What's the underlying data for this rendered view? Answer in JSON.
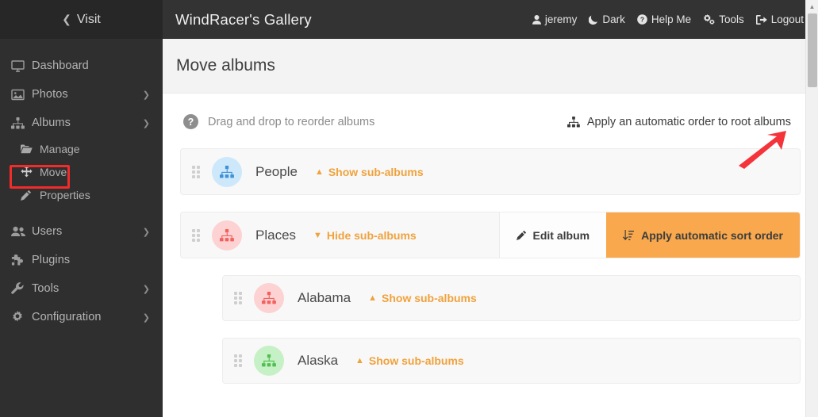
{
  "sidebar": {
    "visit": {
      "label": "Visit",
      "icon": "chevron-left-icon"
    },
    "items": [
      {
        "label": "Dashboard",
        "icon": "desktop-icon",
        "caret": false
      },
      {
        "label": "Photos",
        "icon": "image-icon",
        "caret": true
      },
      {
        "label": "Albums",
        "icon": "sitemap-icon",
        "caret": true
      }
    ],
    "album_subitems": [
      {
        "label": "Manage",
        "icon": "folder-icon",
        "highlighted": false
      },
      {
        "label": "Move",
        "icon": "arrows-alt-icon",
        "highlighted": true
      },
      {
        "label": "Properties",
        "icon": "pencil-icon",
        "highlighted": false
      }
    ],
    "items_lower": [
      {
        "label": "Users",
        "icon": "users-icon",
        "caret": true
      },
      {
        "label": "Plugins",
        "icon": "puzzle-piece-icon",
        "caret": false
      },
      {
        "label": "Tools",
        "icon": "wrench-icon",
        "caret": true
      },
      {
        "label": "Configuration",
        "icon": "gear-icon",
        "caret": true
      }
    ]
  },
  "header": {
    "app_title": "WindRacer's Gallery",
    "nav": [
      {
        "label": "jeremy",
        "icon": "user-icon"
      },
      {
        "label": "Dark",
        "icon": "moon-icon"
      },
      {
        "label": "Help Me",
        "icon": "question-circle-icon"
      },
      {
        "label": "Tools",
        "icon": "cogs-icon"
      },
      {
        "label": "Logout",
        "icon": "sign-out-icon"
      }
    ]
  },
  "page": {
    "title": "Move albums",
    "hint": "Drag and drop to reorder albums",
    "hint_icon": "question-mark-icon",
    "auto_order_link": "Apply an automatic order to root albums",
    "auto_order_icon": "sitemap-icon"
  },
  "albums": [
    {
      "name": "People",
      "toggle_label": "Show sub-albums",
      "toggle_state": "collapsed",
      "avatar_bg": "#cde7fb",
      "avatar_fg": "#3f92d6",
      "level": 0,
      "actions": []
    },
    {
      "name": "Places",
      "toggle_label": "Hide sub-albums",
      "toggle_state": "expanded",
      "avatar_bg": "#fcd2d2",
      "avatar_fg": "#f2615f",
      "level": 0,
      "actions": [
        {
          "label": "Edit album",
          "icon": "pencil-icon",
          "style": "light"
        },
        {
          "label": "Apply automatic sort order",
          "icon": "sort-amount-down-icon",
          "style": "orange"
        }
      ]
    },
    {
      "name": "Alabama",
      "toggle_label": "Show sub-albums",
      "toggle_state": "collapsed",
      "avatar_bg": "#fcd2d2",
      "avatar_fg": "#f2615f",
      "level": 1,
      "actions": []
    },
    {
      "name": "Alaska",
      "toggle_label": "Show sub-albums",
      "toggle_state": "collapsed",
      "avatar_bg": "#c6f0c6",
      "avatar_fg": "#4fbf4f",
      "level": 1,
      "actions": []
    }
  ],
  "annotations": {
    "move_highlight_color": "#f22b2b",
    "arrow_color": "#f4333a",
    "arrows": [
      {
        "name": "arrow-to-auto-order-link",
        "direction": "up-right"
      },
      {
        "name": "arrow-to-apply-sort-button",
        "direction": "down"
      }
    ]
  },
  "scrollbar": {
    "orientation": "vertical",
    "position": "top"
  },
  "colors": {
    "accent_orange": "#f9a84d",
    "link_orange": "#f0a23c",
    "sidebar_bg": "#2f2f2f",
    "topbar_bg": "#333333"
  }
}
